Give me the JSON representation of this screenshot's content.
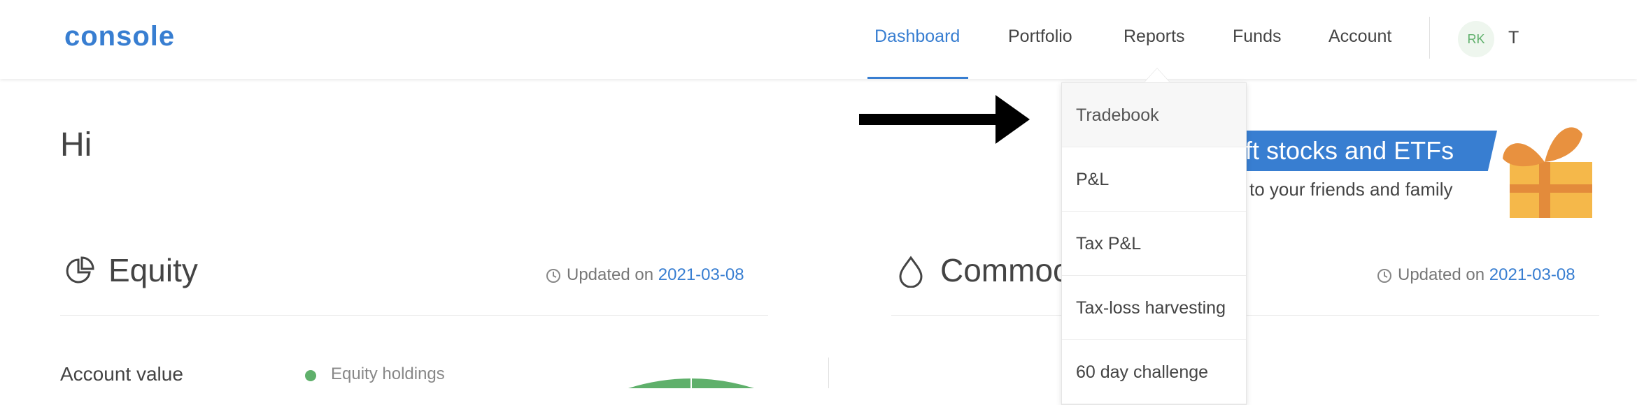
{
  "brand": {
    "logo_text": "console"
  },
  "nav": {
    "items": [
      {
        "label": "Dashboard",
        "active": true
      },
      {
        "label": "Portfolio",
        "active": false
      },
      {
        "label": "Reports",
        "active": false
      },
      {
        "label": "Funds",
        "active": false
      },
      {
        "label": "Account",
        "active": false
      }
    ],
    "avatar_initials": "RK",
    "username": "T"
  },
  "greeting": "Hi",
  "banner": {
    "title": "ft stocks and ETFs",
    "subtitle": "to your friends and family"
  },
  "sections": {
    "equity": {
      "title": "Equity",
      "updated_prefix": "Updated on",
      "updated_date": "2021-03-08",
      "icon": "pie-chart-icon"
    },
    "commodity": {
      "title": "Commoc",
      "updated_prefix": "Updated on",
      "updated_date": "2021-03-08",
      "icon": "drop-icon"
    }
  },
  "equity_details": {
    "account_value_label": "Account value",
    "legend_label": "Equity holdings"
  },
  "reports_menu": {
    "items": [
      "Tradebook",
      "P&L",
      "Tax P&L",
      "Tax-loss harvesting",
      "60 day challenge"
    ]
  },
  "colors": {
    "accent": "#387ed1",
    "green": "#5fb06b",
    "gift_orange": "#f0a030"
  }
}
